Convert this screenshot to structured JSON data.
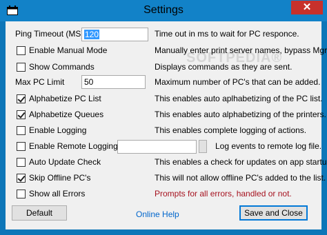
{
  "window": {
    "title": "Settings",
    "close_label": "✕"
  },
  "watermark": "SOFTPEDIA®",
  "settings": {
    "ping_timeout": {
      "label": "Ping Timeout (MS)",
      "value": "120",
      "desc": "Time out in ms to wait for PC responce."
    },
    "manual_mode": {
      "label": "Enable Manual Mode",
      "checked": false,
      "desc": "Manually enter print server names, bypass Mgr."
    },
    "show_commands": {
      "label": "Show Commands",
      "checked": false,
      "desc": "Displays commands as they are sent."
    },
    "max_pc_limit": {
      "label": "Max PC Limit",
      "value": "50",
      "desc": "Maximum number of PC's that can be added."
    },
    "alpha_pc": {
      "label": "Alphabetize PC List",
      "checked": true,
      "desc": "This enables auto aplhabetizing of the PC list."
    },
    "alpha_queues": {
      "label": "Alphabetize Queues",
      "checked": true,
      "desc": "This enables auto alphabetizing of the printers."
    },
    "logging": {
      "label": "Enable Logging",
      "checked": false,
      "desc": "This enables complete logging of actions."
    },
    "remote_logging": {
      "label": "Enable Remote Logging",
      "checked": false,
      "value": "",
      "desc": "Log events to remote log file."
    },
    "auto_update": {
      "label": "Auto Update Check",
      "checked": false,
      "desc": "This enables a check for updates on app startup."
    },
    "skip_offline": {
      "label": "Skip Offline PC's",
      "checked": true,
      "desc": "This will not allow offline PC's added to the list."
    },
    "show_errors": {
      "label": "Show all Errors",
      "checked": false,
      "desc": "Prompts for all errors, handled or not."
    }
  },
  "footer": {
    "default_label": "Default",
    "help_label": "Online Help",
    "save_label": "Save and Close"
  },
  "colors": {
    "title_bar": "#1282c8",
    "close": "#c7312b",
    "error_text": "#a5111e",
    "link": "#0066cc"
  }
}
